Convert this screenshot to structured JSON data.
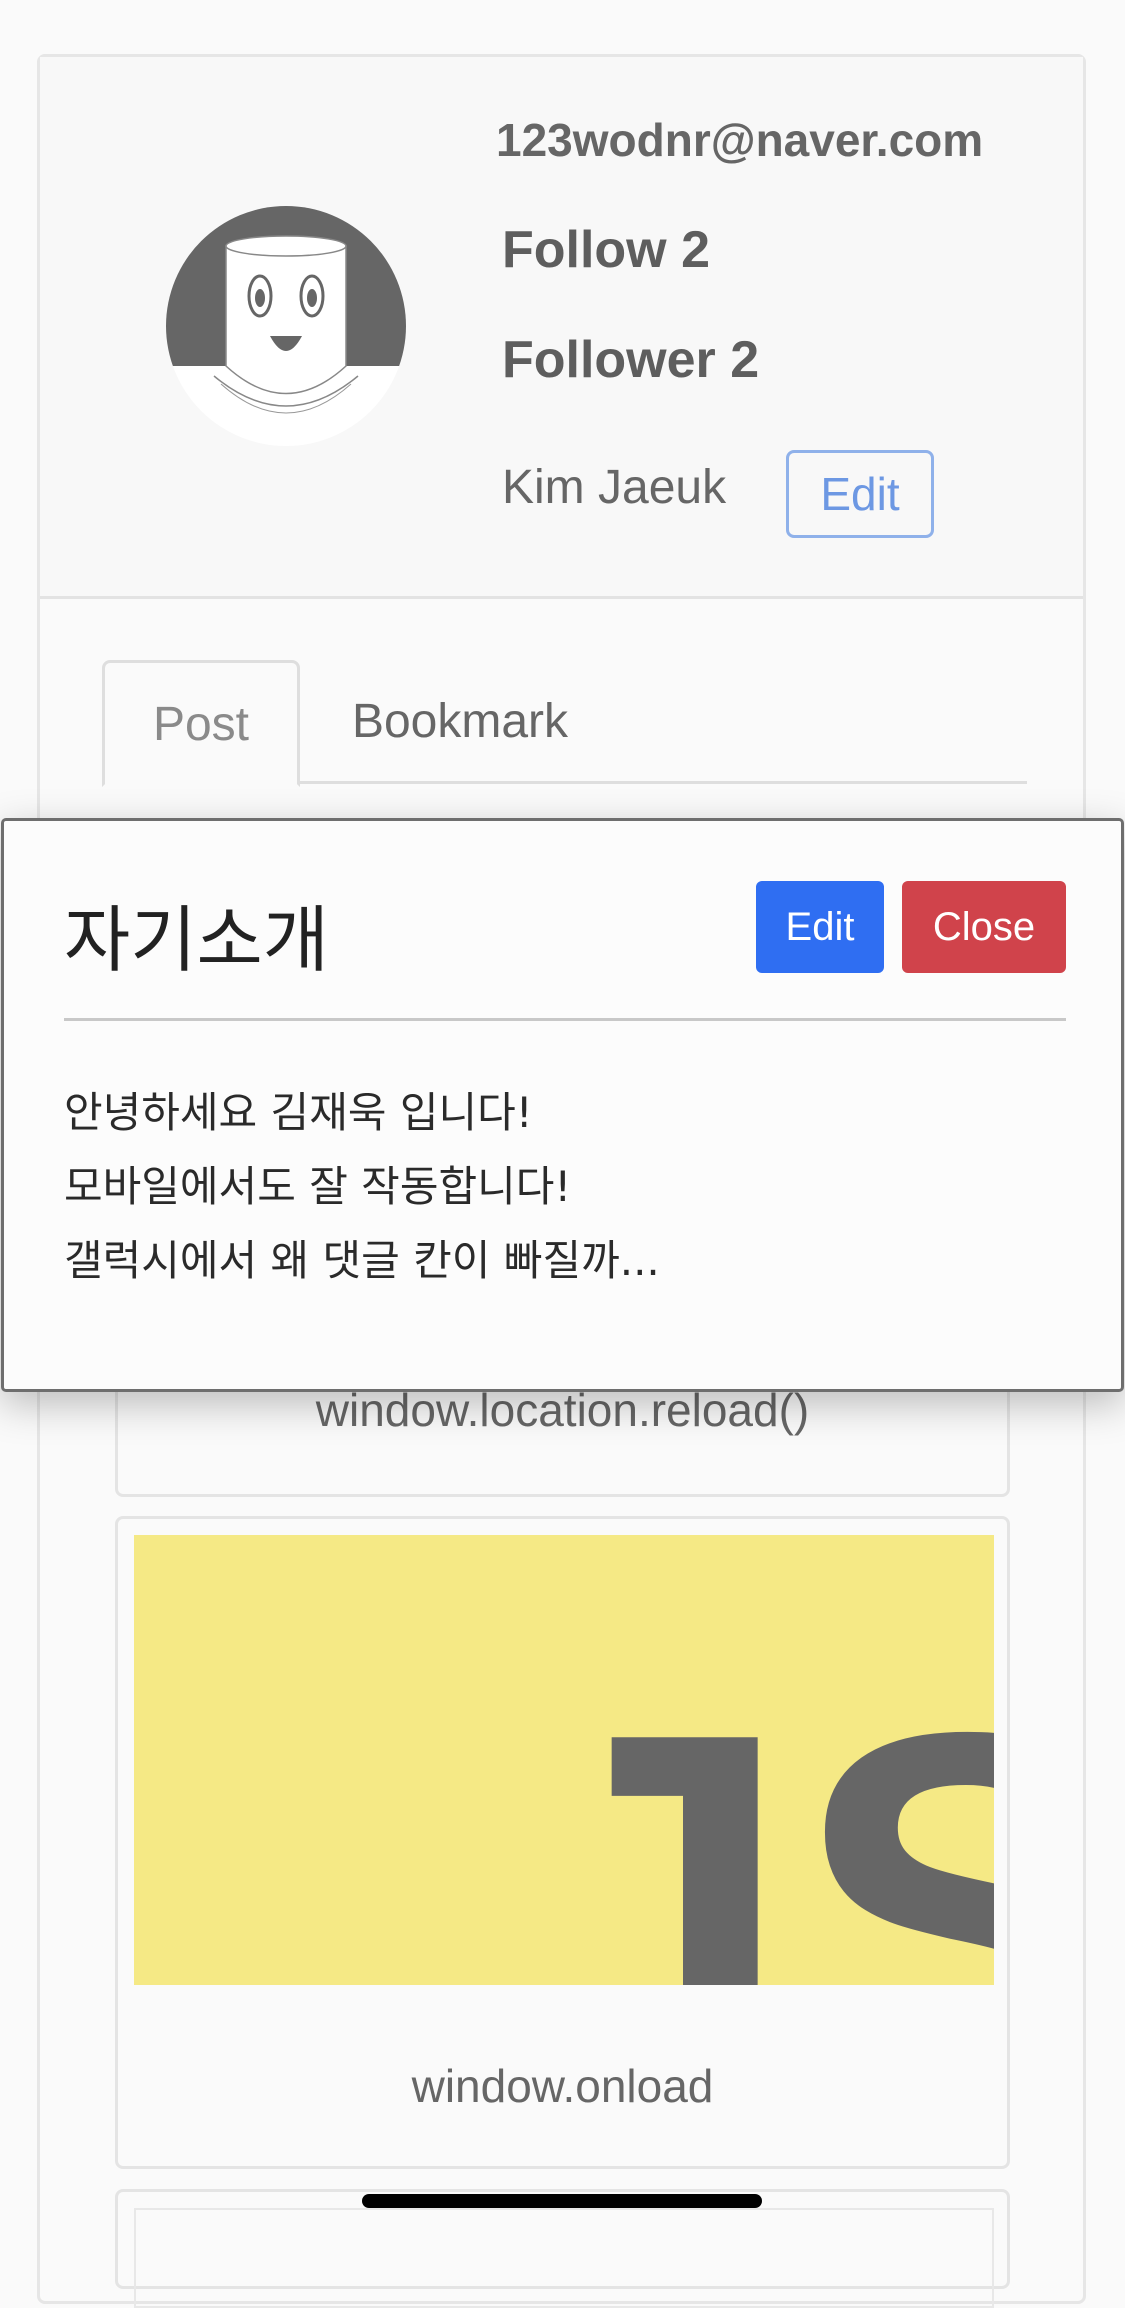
{
  "profile": {
    "email": "123wodnr@naver.com",
    "follow_label": "Follow 2",
    "follower_label": "Follower 2",
    "name": "Kim Jaeuk",
    "edit_label": "Edit"
  },
  "tabs": [
    {
      "label": "Post",
      "active": true
    },
    {
      "label": "Bookmark",
      "active": false
    }
  ],
  "posts": [
    {
      "caption": "window.location.reload()"
    },
    {
      "caption": "window.onload",
      "thumbnail_text": "JS",
      "thumbnail_color": "#f5e985"
    }
  ],
  "modal": {
    "title": "자기소개",
    "edit_label": "Edit",
    "close_label": "Close",
    "body_lines": [
      "안녕하세요 김재욱 입니다!",
      "모바일에서도 잘 작동합니다!",
      "갤럭시에서 왜 댓글 칸이 빠질까..."
    ]
  },
  "colors": {
    "primary": "#2f6ef2",
    "danger": "#d0434b",
    "outline_accent": "#6d98e3"
  }
}
